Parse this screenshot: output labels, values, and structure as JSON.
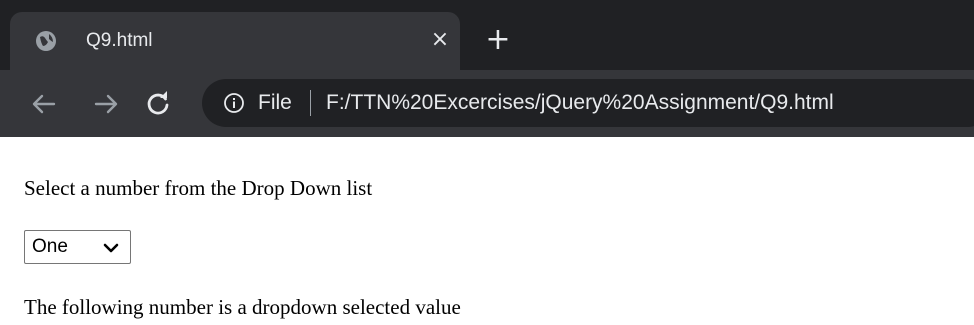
{
  "browser": {
    "tab": {
      "title": "Q9.html",
      "favicon": "globe-icon",
      "close": "×"
    },
    "new_tab": "+",
    "toolbar": {
      "back": "arrow-left-icon",
      "forward": "arrow-right-icon",
      "reload": "reload-icon",
      "info": "info-icon",
      "scheme_label": "File",
      "url": "F:/TTN%20Excercises/jQuery%20Assignment/Q9.html"
    }
  },
  "page": {
    "prompt": "Select a number from the Drop Down list",
    "dropdown": {
      "selected": "One"
    },
    "result_text": "The following number is a dropdown selected value"
  },
  "colors": {
    "tabstrip": "#202124",
    "active_tab": "#35363a",
    "omnibox": "#202124",
    "chrome_text": "#e8eaed"
  }
}
